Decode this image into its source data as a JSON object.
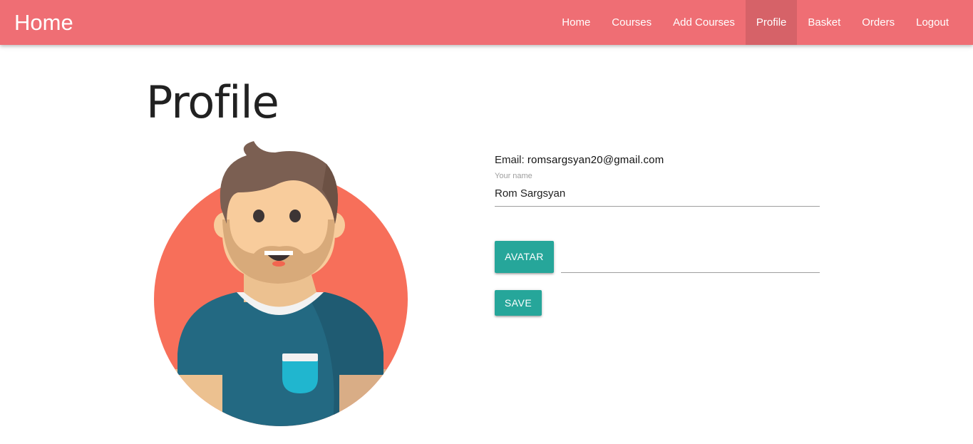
{
  "navbar": {
    "brand": "Home",
    "links": [
      {
        "label": "Home"
      },
      {
        "label": "Courses"
      },
      {
        "label": "Add Courses"
      },
      {
        "label": "Profile",
        "active": true
      },
      {
        "label": "Basket"
      },
      {
        "label": "Orders"
      },
      {
        "label": "Logout"
      }
    ],
    "color": "#ef6e74"
  },
  "page": {
    "title": "Profile"
  },
  "avatar": {
    "icon": "bearded-man-avatar-icon",
    "circle_color": "#f76f5a"
  },
  "profile_form": {
    "email_label": "Email:",
    "email_value": "romsargsyan20@gmail.com",
    "name_label": "Your name",
    "name_value": "Rom Sargsyan",
    "avatar_button": "Avatar",
    "file_path_value": "",
    "save_button": "Save",
    "button_color": "#26a69a"
  }
}
